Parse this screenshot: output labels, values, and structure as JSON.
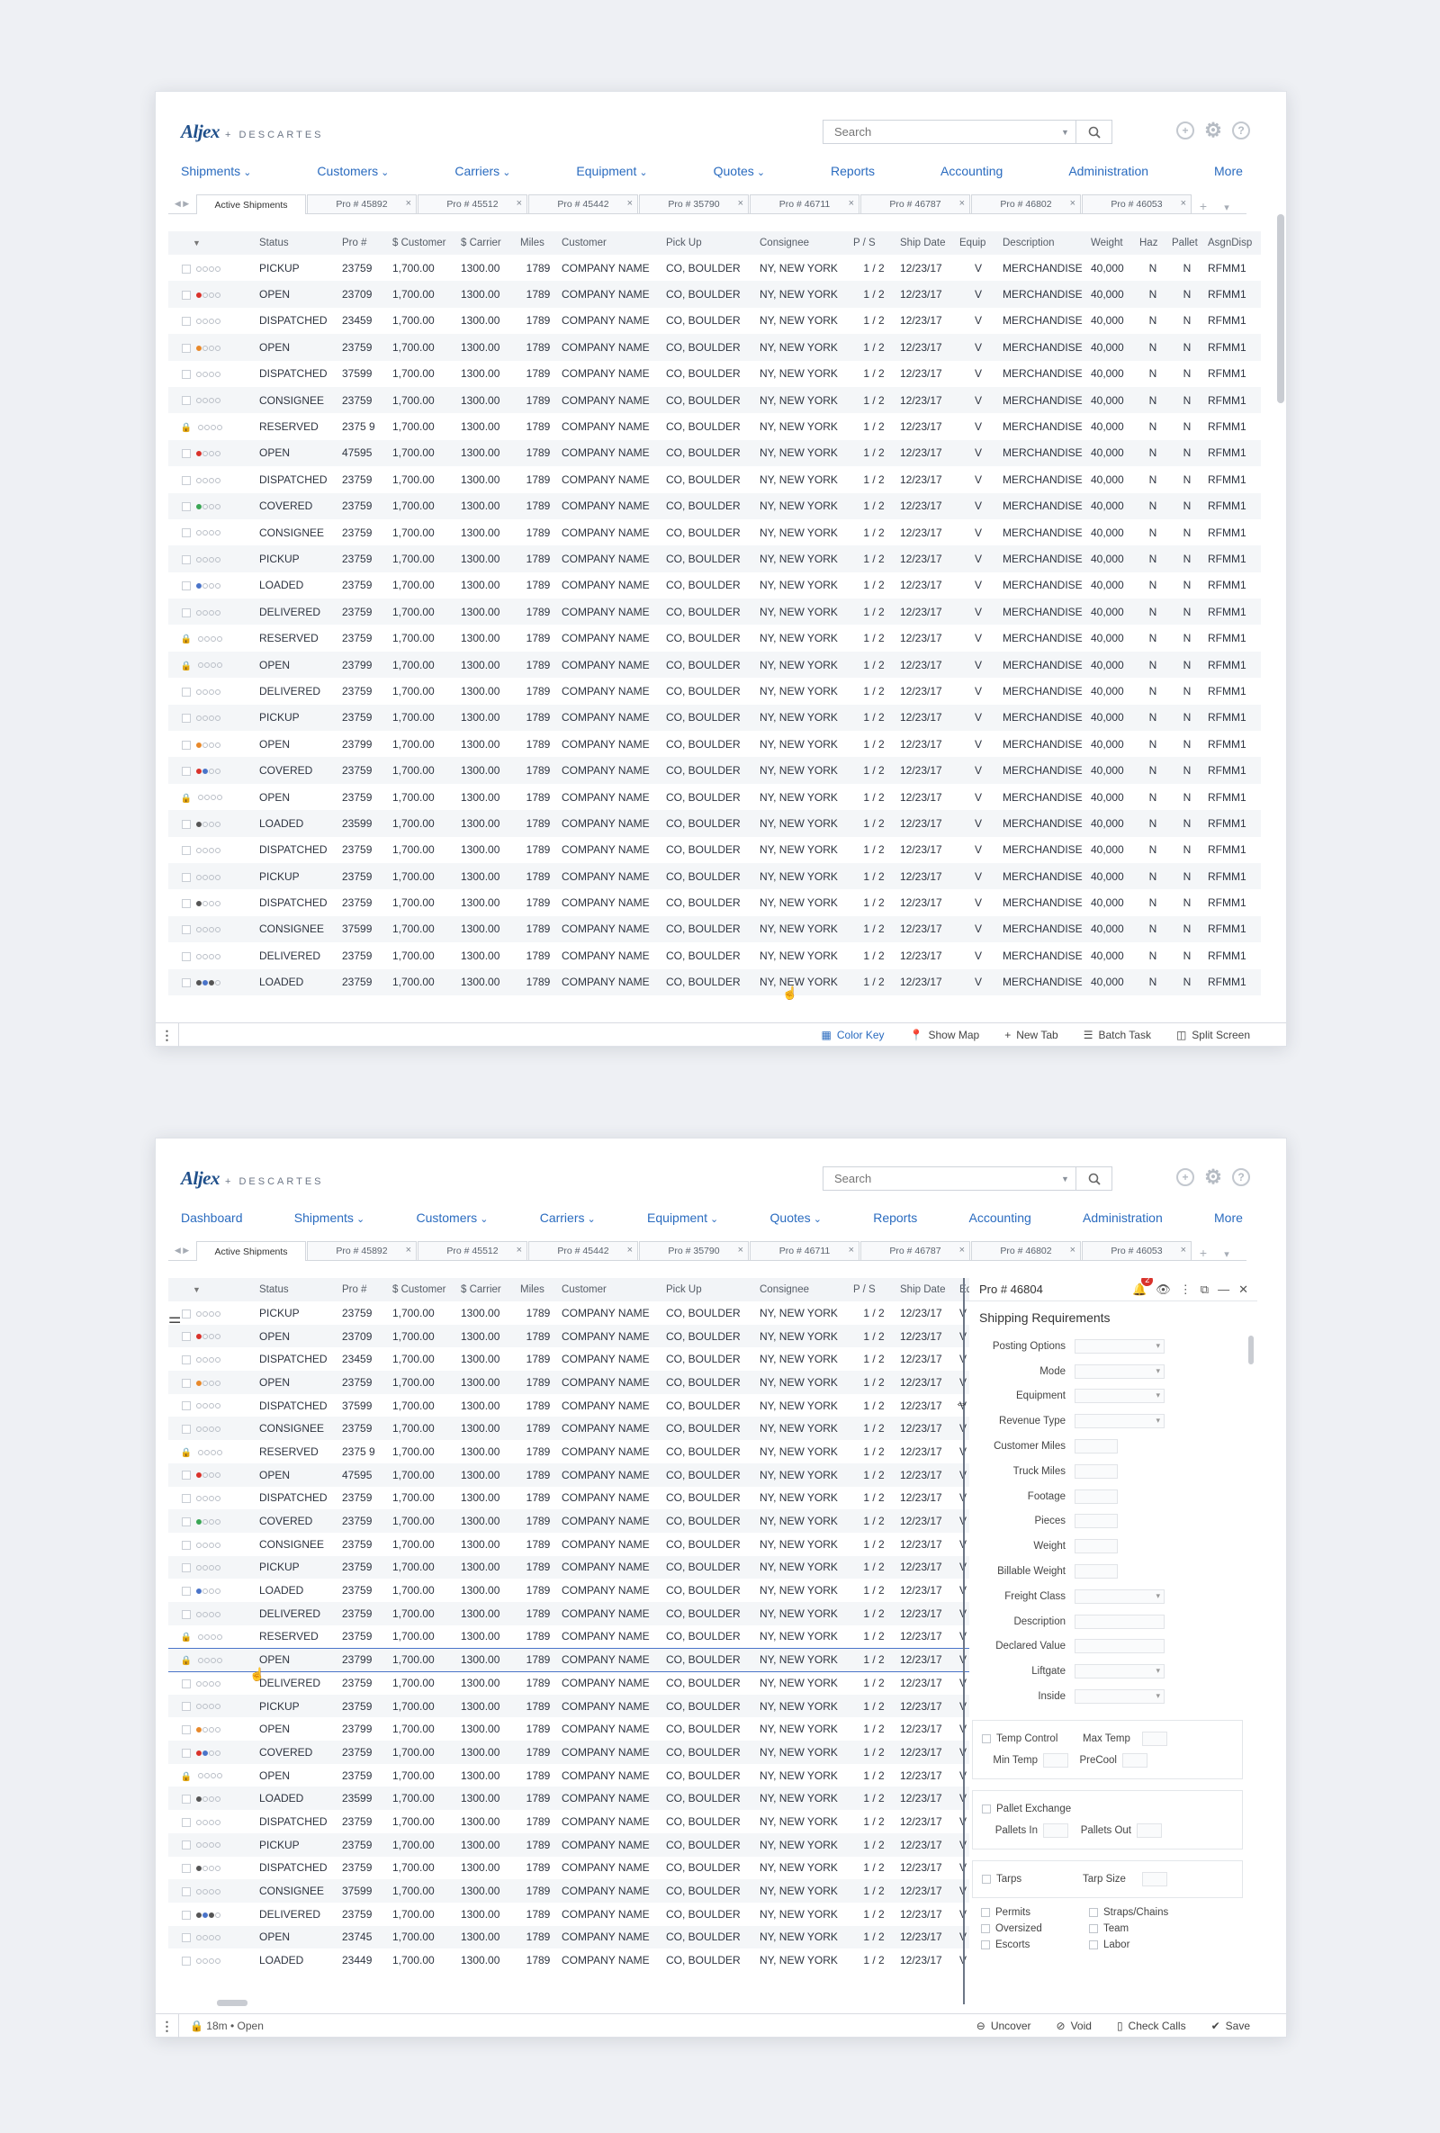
{
  "brand": {
    "name": "Aljex",
    "partner": "+ DESCARTES"
  },
  "search": {
    "placeholder": "Search"
  },
  "nav1": [
    "Shipments",
    "Customers",
    "Carriers",
    "Equipment",
    "Quotes",
    "Reports",
    "Accounting",
    "Administration",
    "More"
  ],
  "nav1_dropdown": [
    true,
    true,
    true,
    true,
    true,
    false,
    false,
    false,
    false
  ],
  "nav2": [
    "Dashboard",
    "Shipments",
    "Customers",
    "Carriers",
    "Equipment",
    "Quotes",
    "Reports",
    "Accounting",
    "Administration",
    "More"
  ],
  "nav2_dropdown": [
    false,
    true,
    true,
    true,
    true,
    true,
    false,
    false,
    false,
    false
  ],
  "tabs": [
    "Active Shipments",
    "Pro # 45892",
    "Pro # 45512",
    "Pro # 45442",
    "Pro # 35790",
    "Pro # 46711",
    "Pro # 46787",
    "Pro # 46802",
    "Pro # 46053"
  ],
  "columns": [
    "Status",
    "Pro #",
    "$ Customer",
    "$ Carrier",
    "Miles",
    "Customer",
    "Pick Up",
    "Consignee",
    "P / S",
    "Ship Date",
    "Equip",
    "Description",
    "Weight",
    "Haz",
    "Pallet",
    "AsgnDisp"
  ],
  "columns2_truncated": "Eq",
  "rows": [
    {
      "icon": "cb",
      "dots": [],
      "status": "PICKUP",
      "pro": "23759"
    },
    {
      "icon": "cb",
      "dots": [
        "#d9322b"
      ],
      "status": "OPEN",
      "pro": "23709"
    },
    {
      "icon": "cb",
      "dots": [],
      "status": "DISPATCHED",
      "pro": "23459"
    },
    {
      "icon": "cb",
      "dots": [
        "#e8892b"
      ],
      "status": "OPEN",
      "pro": "23759"
    },
    {
      "icon": "cb",
      "dots": [],
      "status": "DISPATCHED",
      "pro": "37599"
    },
    {
      "icon": "cb",
      "dots": [],
      "status": "CONSIGNEE",
      "pro": "23759"
    },
    {
      "icon": "lock",
      "dots": [],
      "status": "RESERVED",
      "pro": "2375 9"
    },
    {
      "icon": "cb",
      "dots": [
        "#d9322b"
      ],
      "status": "OPEN",
      "pro": "47595"
    },
    {
      "icon": "cb",
      "dots": [],
      "status": "DISPATCHED",
      "pro": "23759"
    },
    {
      "icon": "cb",
      "dots": [
        "#3aa655"
      ],
      "status": "COVERED",
      "pro": "23759"
    },
    {
      "icon": "cb",
      "dots": [],
      "status": "CONSIGNEE",
      "pro": "23759"
    },
    {
      "icon": "cb",
      "dots": [],
      "status": "PICKUP",
      "pro": "23759"
    },
    {
      "icon": "cb",
      "dots": [
        "#4a74c9"
      ],
      "status": "LOADED",
      "pro": "23759"
    },
    {
      "icon": "cb",
      "dots": [],
      "status": "DELIVERED",
      "pro": "23759"
    },
    {
      "icon": "lock",
      "dots": [],
      "status": "RESERVED",
      "pro": "23759"
    },
    {
      "icon": "lock",
      "dots": [],
      "status": "OPEN",
      "pro": "23799"
    },
    {
      "icon": "cb",
      "dots": [],
      "status": "DELIVERED",
      "pro": "23759"
    },
    {
      "icon": "cb",
      "dots": [],
      "status": "PICKUP",
      "pro": "23759"
    },
    {
      "icon": "cb",
      "dots": [
        "#e8892b"
      ],
      "status": "OPEN",
      "pro": "23799"
    },
    {
      "icon": "cb",
      "dots": [
        "#d9322b",
        "#4a74c9"
      ],
      "status": "COVERED",
      "pro": "23759"
    },
    {
      "icon": "lock",
      "dots": [],
      "status": "OPEN",
      "pro": "23759"
    },
    {
      "icon": "cb",
      "dots": [
        "#555"
      ],
      "status": "LOADED",
      "pro": "23599"
    },
    {
      "icon": "cb",
      "dots": [],
      "status": "DISPATCHED",
      "pro": "23759"
    },
    {
      "icon": "cb",
      "dots": [],
      "status": "PICKUP",
      "pro": "23759"
    },
    {
      "icon": "cb",
      "dots": [
        "#555"
      ],
      "status": "DISPATCHED",
      "pro": "23759"
    },
    {
      "icon": "cb",
      "dots": [],
      "status": "CONSIGNEE",
      "pro": "37599"
    },
    {
      "icon": "cb",
      "dots": [],
      "status": "DELIVERED",
      "pro": "23759"
    },
    {
      "icon": "cb",
      "dots": [
        "#555",
        "#4a74c9",
        "#555"
      ],
      "status": "LOADED",
      "pro": "23759"
    }
  ],
  "rows2_extra": [
    {
      "icon": "cb",
      "dots": [],
      "status": "OPEN",
      "pro": "23745"
    },
    {
      "icon": "cb",
      "dots": [],
      "status": "LOADED",
      "pro": "23449"
    }
  ],
  "common": {
    "customer_amt": "1,700.00",
    "carrier_amt": "1300.00",
    "miles": "1789",
    "customer": "COMPANY NAME",
    "pickup": "CO, BOULDER",
    "consignee": "NY, NEW YORK",
    "ps": "1 / 2",
    "ship_date": "12/23/17",
    "equip": "V",
    "description": "MERCHANDISE",
    "weight": "40,000",
    "haz": "N",
    "pallet": "N",
    "asgn": "RFMM1"
  },
  "footer1": {
    "color_key": "Color Key",
    "show_map": "Show Map",
    "new_tab": "New Tab",
    "batch_task": "Batch Task",
    "split_screen": "Split Screen"
  },
  "footer2": {
    "status": "18m • Open",
    "uncover": "Uncover",
    "void": "Void",
    "check_calls": "Check Calls",
    "save": "Save"
  },
  "panel": {
    "title": "Pro # 46804",
    "notif": "2",
    "section": "Shipping Requirements",
    "fields": [
      {
        "label": "Posting Options",
        "type": "sel"
      },
      {
        "label": "Mode",
        "type": "sel"
      },
      {
        "label": "Equipment",
        "type": "sel"
      },
      {
        "label": "Revenue Type",
        "type": "sel"
      },
      {
        "label": "Customer Miles",
        "type": "inp"
      },
      {
        "label": "Truck Miles",
        "type": "inp"
      },
      {
        "label": "Footage",
        "type": "inp"
      },
      {
        "label": "Pieces",
        "type": "inp"
      },
      {
        "label": "Weight",
        "type": "inp"
      },
      {
        "label": "Billable Weight",
        "type": "inp"
      },
      {
        "label": "Freight Class",
        "type": "sel"
      },
      {
        "label": "Description",
        "type": "inpw"
      },
      {
        "label": "Declared Value",
        "type": "inpw"
      },
      {
        "label": "Liftgate",
        "type": "sel"
      },
      {
        "label": "Inside",
        "type": "sel"
      }
    ],
    "temp_control": "Temp Control",
    "max_temp": "Max Temp",
    "min_temp": "Min Temp",
    "precool": "PreCool",
    "pallet_exchange": "Pallet Exchange",
    "pallets_in": "Pallets In",
    "pallets_out": "Pallets Out",
    "tarps": "Tarps",
    "tarp_size": "Tarp Size",
    "checks": [
      "Permits",
      "Straps/Chains",
      "Oversized",
      "Team",
      "Escorts",
      "Labor"
    ]
  }
}
